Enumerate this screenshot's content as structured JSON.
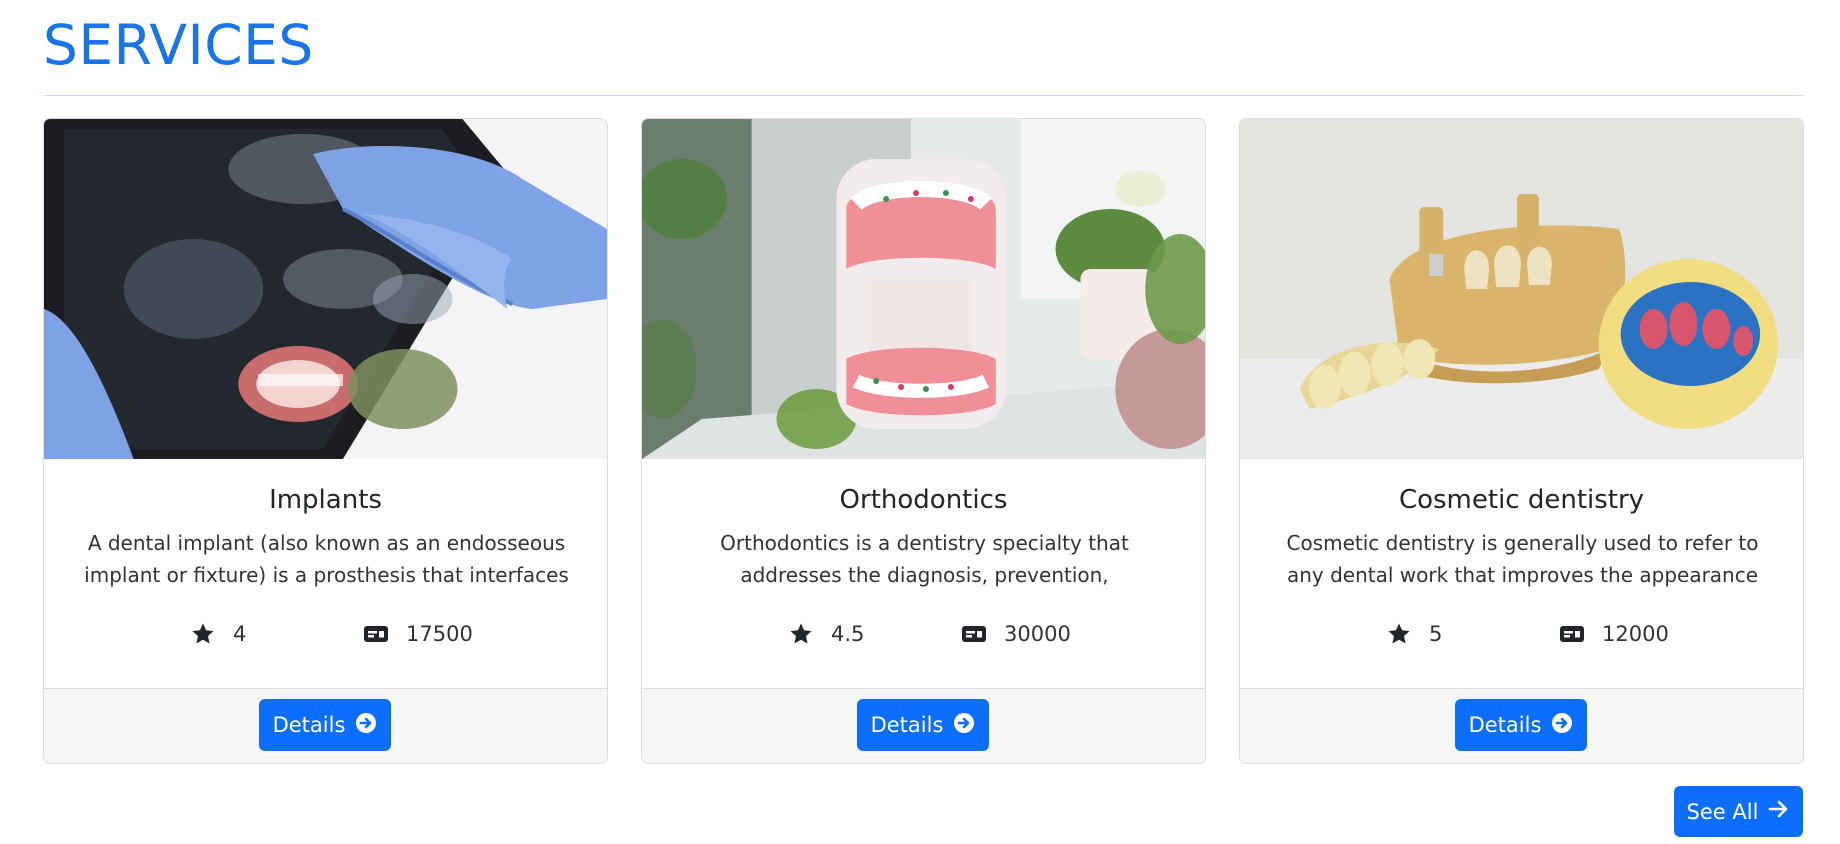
{
  "page": {
    "title": "SERVICES"
  },
  "services": [
    {
      "title": "Implants",
      "description": "A dental implant (also known as an endosseous implant or fixture) is a prosthesis that interfaces wi",
      "rating": "4",
      "price": "17500",
      "button_label": "Details",
      "image": "dental-xray-tablet-photo"
    },
    {
      "title": "Orthodontics",
      "description": "Orthodontics is a dentistry specialty that addresses the diagnosis, prevention, management, and corr",
      "rating": "4.5",
      "price": "30000",
      "button_label": "Details",
      "image": "braces-teeth-model-photo"
    },
    {
      "title": "Cosmetic dentistry",
      "description": "Cosmetic dentistry is generally used to refer to any dental work that improves the appearance (thoug",
      "rating": "5",
      "price": "12000",
      "button_label": "Details",
      "image": "dental-cast-model-photo"
    }
  ],
  "see_all": {
    "label": "See All"
  },
  "icons": {
    "rating": "star-icon",
    "price": "price-card-icon",
    "details": "arrow-circle-right-icon",
    "see_all": "arrow-right-icon"
  },
  "colors": {
    "accent": "#1a73e8",
    "button": "#0d6efd"
  }
}
